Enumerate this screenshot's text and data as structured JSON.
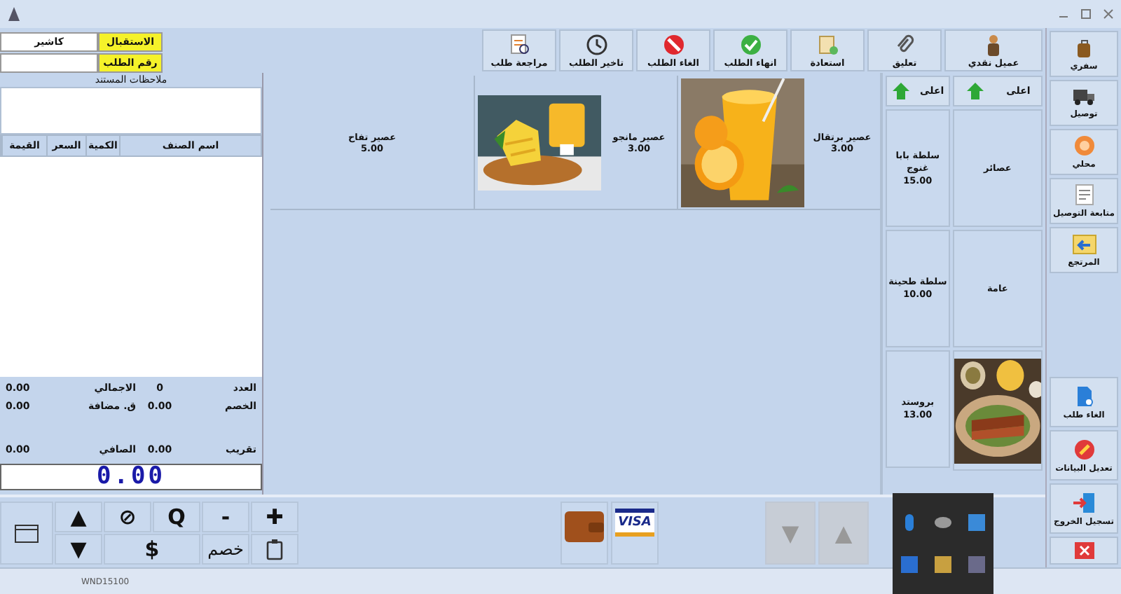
{
  "fields": [
    {
      "label": "الاستقبال",
      "value": "كاشير"
    },
    {
      "label": "رقم الطلب"
    }
  ],
  "toolbar": [
    "عميل نقدي",
    "تعليق",
    "استعادة",
    "انهاء الطلب",
    "الغاء الطلب",
    "تاخير الطلب",
    "مراجعة طلب"
  ],
  "sidebar": {
    "top": [
      "سفري",
      "توصيل",
      "محلي",
      "متابعة التوصيل",
      "المرتجع"
    ],
    "bottom": [
      "الغاء طلب",
      "تعديل البيانات",
      "تسجيل الخروج"
    ]
  },
  "order": {
    "notes_label": "ملاحظات المستند",
    "columns": [
      "اسم الصنف",
      "الكمية",
      "السعر",
      "القيمة"
    ],
    "totals": [
      {
        "label": "العدد",
        "value": "0"
      },
      {
        "label": "الاجمالي",
        "value": "0.00"
      },
      {
        "label": "الخصم",
        "value": "0.00"
      },
      {
        "label": "ق. مضافة",
        "value": "0.00"
      },
      {
        "label": "تقريب",
        "value": "0.00"
      },
      {
        "label": "الصافي",
        "value": "0.00"
      }
    ],
    "display": "0.00"
  },
  "products": [
    {
      "name": "عصير برتقال",
      "price": "3.00",
      "kind": "picture"
    },
    {
      "name": "عصير مانجو",
      "price": "3.00",
      "kind": "picture"
    },
    {
      "name": "عصير تفاح",
      "price": "5.00"
    }
  ],
  "categories": [
    [
      {
        "kind": "up",
        "name": "اعلى"
      },
      {
        "name": "عصائر"
      },
      {
        "name": "عامة"
      },
      {
        "kind": "picture"
      }
    ],
    [
      {
        "kind": "up",
        "name": "اعلى"
      },
      {
        "name": "سلطة بابا غنوج",
        "price": "15.00"
      },
      {
        "name": "سلطة طحينة",
        "price": "10.00"
      },
      {
        "name": "بروستد",
        "price": "13.00"
      }
    ]
  ],
  "keypad": {
    "top": [
      "✚",
      "-",
      "Q",
      "⊘",
      "▲"
    ],
    "bottom": [
      "خصم",
      "$",
      "▼"
    ]
  },
  "payments": [
    {
      "kind": "wallet"
    },
    {
      "kind": "card",
      "label": "VISA"
    }
  ],
  "nav": [
    "▲",
    "▼"
  ],
  "status": "WND15100"
}
